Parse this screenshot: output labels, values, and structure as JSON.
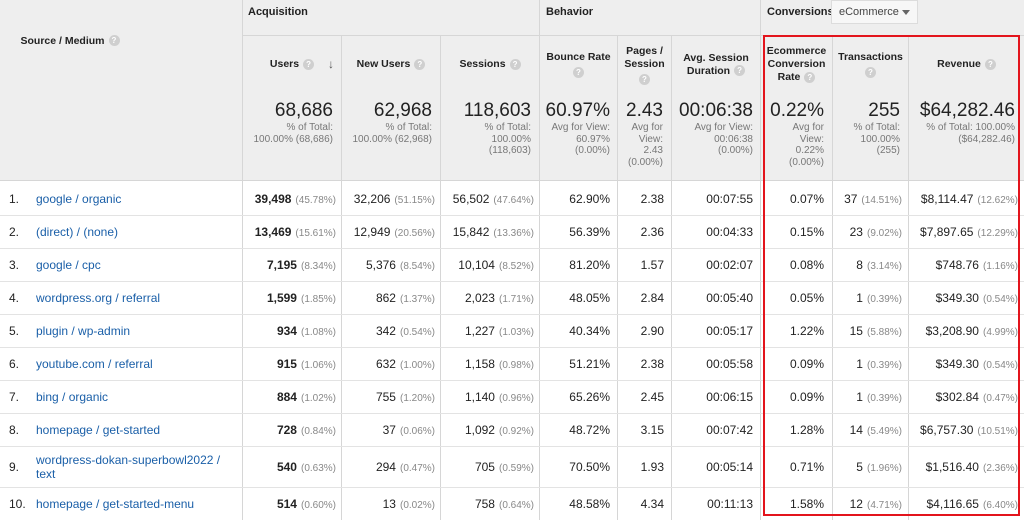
{
  "groups": {
    "acquisition": "Acquisition",
    "behavior": "Behavior",
    "conversions": "Conversions",
    "conversion_select": "eCommerce"
  },
  "headers": {
    "source_medium": "Source / Medium",
    "users": "Users",
    "new_users": "New Users",
    "sessions": "Sessions",
    "bounce_rate": "Bounce Rate",
    "pages_session_1": "Pages /",
    "pages_session_2": "Session",
    "avg_session_1": "Avg. Session",
    "avg_session_2": "Duration",
    "ecr_1": "Ecommerce",
    "ecr_2": "Conversion",
    "ecr_3": "Rate",
    "transactions": "Transactions",
    "revenue": "Revenue",
    "help": "?"
  },
  "totals": {
    "users": {
      "big": "68,686",
      "l1": "% of Total:",
      "l2": "100.00% (68,686)"
    },
    "new_users": {
      "big": "62,968",
      "l1": "% of Total:",
      "l2": "100.00% (62,968)"
    },
    "sessions": {
      "big": "118,603",
      "l1": "% of Total:",
      "l2": "100.00%",
      "l3": "(118,603)"
    },
    "bounce_rate": {
      "big": "60.97%",
      "l1": "Avg for View:",
      "l2": "60.97%",
      "l3": "(0.00%)"
    },
    "pages_session": {
      "big": "2.43",
      "l1": "Avg for",
      "l2": "View:",
      "l3": "2.43",
      "l4": "(0.00%)"
    },
    "avg_duration": {
      "big": "00:06:38",
      "l1": "Avg for View:",
      "l2": "00:06:38",
      "l3": "(0.00%)"
    },
    "ecr": {
      "big": "0.22%",
      "l1": "Avg for",
      "l2": "View:",
      "l3": "0.22%",
      "l4": "(0.00%)"
    },
    "transactions": {
      "big": "255",
      "l1": "% of Total:",
      "l2": "100.00%",
      "l3": "(255)"
    },
    "revenue": {
      "big": "$64,282.46",
      "l1": "% of Total: 100.00%",
      "l2": "($64,282.46)"
    }
  },
  "rows": [
    {
      "idx": "1.",
      "src": "google / organic",
      "users": "39,498",
      "users_pct": "(45.78%)",
      "new": "32,206",
      "new_pct": "(51.15%)",
      "sess": "56,502",
      "sess_pct": "(47.64%)",
      "bounce": "62.90%",
      "pages": "2.38",
      "dur": "00:07:55",
      "ecr": "0.07%",
      "tx": "37",
      "tx_pct": "(14.51%)",
      "rev": "$8,114.47",
      "rev_pct": "(12.62%)"
    },
    {
      "idx": "2.",
      "src": "(direct) / (none)",
      "users": "13,469",
      "users_pct": "(15.61%)",
      "new": "12,949",
      "new_pct": "(20.56%)",
      "sess": "15,842",
      "sess_pct": "(13.36%)",
      "bounce": "56.39%",
      "pages": "2.36",
      "dur": "00:04:33",
      "ecr": "0.15%",
      "tx": "23",
      "tx_pct": "(9.02%)",
      "rev": "$7,897.65",
      "rev_pct": "(12.29%)"
    },
    {
      "idx": "3.",
      "src": "google / cpc",
      "users": "7,195",
      "users_pct": "(8.34%)",
      "new": "5,376",
      "new_pct": "(8.54%)",
      "sess": "10,104",
      "sess_pct": "(8.52%)",
      "bounce": "81.20%",
      "pages": "1.57",
      "dur": "00:02:07",
      "ecr": "0.08%",
      "tx": "8",
      "tx_pct": "(3.14%)",
      "rev": "$748.76",
      "rev_pct": "(1.16%)"
    },
    {
      "idx": "4.",
      "src": "wordpress.org / referral",
      "users": "1,599",
      "users_pct": "(1.85%)",
      "new": "862",
      "new_pct": "(1.37%)",
      "sess": "2,023",
      "sess_pct": "(1.71%)",
      "bounce": "48.05%",
      "pages": "2.84",
      "dur": "00:05:40",
      "ecr": "0.05%",
      "tx": "1",
      "tx_pct": "(0.39%)",
      "rev": "$349.30",
      "rev_pct": "(0.54%)"
    },
    {
      "idx": "5.",
      "src": "plugin / wp-admin",
      "users": "934",
      "users_pct": "(1.08%)",
      "new": "342",
      "new_pct": "(0.54%)",
      "sess": "1,227",
      "sess_pct": "(1.03%)",
      "bounce": "40.34%",
      "pages": "2.90",
      "dur": "00:05:17",
      "ecr": "1.22%",
      "tx": "15",
      "tx_pct": "(5.88%)",
      "rev": "$3,208.90",
      "rev_pct": "(4.99%)"
    },
    {
      "idx": "6.",
      "src": "youtube.com / referral",
      "users": "915",
      "users_pct": "(1.06%)",
      "new": "632",
      "new_pct": "(1.00%)",
      "sess": "1,158",
      "sess_pct": "(0.98%)",
      "bounce": "51.21%",
      "pages": "2.38",
      "dur": "00:05:58",
      "ecr": "0.09%",
      "tx": "1",
      "tx_pct": "(0.39%)",
      "rev": "$349.30",
      "rev_pct": "(0.54%)"
    },
    {
      "idx": "7.",
      "src": "bing / organic",
      "users": "884",
      "users_pct": "(1.02%)",
      "new": "755",
      "new_pct": "(1.20%)",
      "sess": "1,140",
      "sess_pct": "(0.96%)",
      "bounce": "65.26%",
      "pages": "2.45",
      "dur": "00:06:15",
      "ecr": "0.09%",
      "tx": "1",
      "tx_pct": "(0.39%)",
      "rev": "$302.84",
      "rev_pct": "(0.47%)"
    },
    {
      "idx": "8.",
      "src": "homepage / get-started",
      "users": "728",
      "users_pct": "(0.84%)",
      "new": "37",
      "new_pct": "(0.06%)",
      "sess": "1,092",
      "sess_pct": "(0.92%)",
      "bounce": "48.72%",
      "pages": "3.15",
      "dur": "00:07:42",
      "ecr": "1.28%",
      "tx": "14",
      "tx_pct": "(5.49%)",
      "rev": "$6,757.30",
      "rev_pct": "(10.51%)"
    },
    {
      "idx": "9.",
      "src": "wordpress-dokan-superbowl2022 /",
      "src2": "text",
      "users": "540",
      "users_pct": "(0.63%)",
      "new": "294",
      "new_pct": "(0.47%)",
      "sess": "705",
      "sess_pct": "(0.59%)",
      "bounce": "70.50%",
      "pages": "1.93",
      "dur": "00:05:14",
      "ecr": "0.71%",
      "tx": "5",
      "tx_pct": "(1.96%)",
      "rev": "$1,516.40",
      "rev_pct": "(2.36%)"
    },
    {
      "idx": "10.",
      "src": "homepage / get-started-menu",
      "users": "514",
      "users_pct": "(0.60%)",
      "new": "13",
      "new_pct": "(0.02%)",
      "sess": "758",
      "sess_pct": "(0.64%)",
      "bounce": "48.58%",
      "pages": "4.34",
      "dur": "00:11:13",
      "ecr": "1.58%",
      "tx": "12",
      "tx_pct": "(4.71%)",
      "rev": "$4,116.65",
      "rev_pct": "(6.40%)"
    }
  ],
  "colors": {
    "highlight": "#e3141c",
    "link": "#1a5fa8",
    "header_bg": "#eeeeee"
  }
}
